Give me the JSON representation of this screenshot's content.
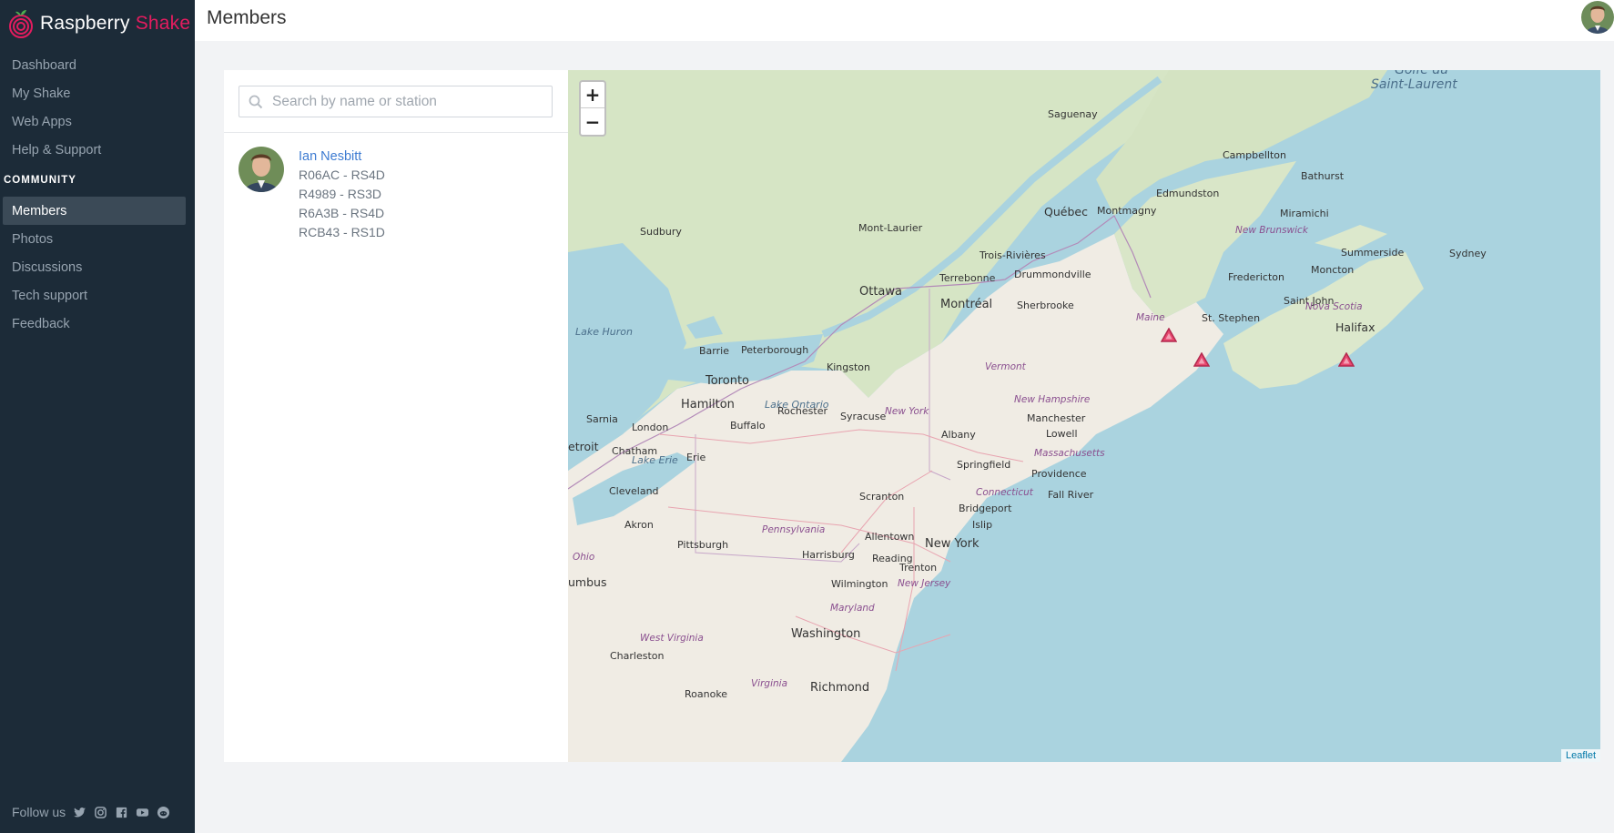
{
  "app": {
    "logo_primary": "Raspberry",
    "logo_accent": "Shake",
    "brand_color": "#e31c5f"
  },
  "sidebar": {
    "items": [
      {
        "label": "Dashboard"
      },
      {
        "label": "My Shake"
      },
      {
        "label": "Web Apps"
      },
      {
        "label": "Help & Support"
      }
    ],
    "section": "COMMUNITY",
    "community_items": [
      {
        "label": "Members",
        "active": true
      },
      {
        "label": "Photos"
      },
      {
        "label": "Discussions"
      },
      {
        "label": "Tech support"
      },
      {
        "label": "Feedback"
      }
    ],
    "follow_label": "Follow us",
    "social_icons": [
      "twitter-icon",
      "instagram-icon",
      "facebook-icon",
      "youtube-icon",
      "reddit-icon"
    ]
  },
  "header": {
    "title": "Members"
  },
  "panel": {
    "search_placeholder": "Search by name or station",
    "members": [
      {
        "name": "Ian Nesbitt",
        "stations": [
          "R06AC - RS4D",
          "R4989 - RS3D",
          "R6A3B - RS4D",
          "RCB43 - RS1D"
        ]
      }
    ]
  },
  "map": {
    "zoom_in": "+",
    "zoom_out": "−",
    "attribution": "Leaflet",
    "labels": {
      "saguenay": "Saguenay",
      "campbellton": "Campbellton",
      "bathurst": "Bathurst",
      "edmundston": "Edmundston",
      "quebec": "Québec",
      "montmagny": "Montmagny",
      "miramichi": "Miramichi",
      "new_brunswick": "New Brunswick",
      "sudbury": "Sudbury",
      "mont_laurier": "Mont-Laurier",
      "summerside": "Summerside",
      "sydney": "Sydney",
      "trois_rivieres": "Trois-Rivières",
      "terrebonne": "Terrebonne",
      "drummondville": "Drummondville",
      "fredericton": "Fredericton",
      "moncton": "Moncton",
      "ottawa": "Ottawa",
      "montreal": "Montréal",
      "sherbrooke": "Sherbrooke",
      "saint_john": "Saint John",
      "nova_scotia": "Nova Scotia",
      "maine": "Maine",
      "st_stephen": "St. Stephen",
      "halifax": "Halifax",
      "lake_huron": "Lake Huron",
      "barrie": "Barrie",
      "peterborough": "Peterborough",
      "vermont": "Vermont",
      "kingston": "Kingston",
      "toronto": "Toronto",
      "lake_ontario": "Lake Ontario",
      "new_hampshire": "New Hampshire",
      "hamilton": "Hamilton",
      "rochester": "Rochester",
      "new_york_state": "New York",
      "syracuse": "Syracuse",
      "manchester": "Manchester",
      "sarnia": "Sarnia",
      "london": "London",
      "buffalo": "Buffalo",
      "albany": "Albany",
      "lowell": "Lowell",
      "detroit": "etroit",
      "chatham": "Chatham",
      "massachusetts": "Massachusetts",
      "lake_erie": "Lake Erie",
      "erie": "Erie",
      "springfield": "Springfield",
      "providence": "Providence",
      "cleveland": "Cleveland",
      "connecticut": "Connecticut",
      "fall_river": "Fall River",
      "scranton": "Scranton",
      "bridgeport": "Bridgeport",
      "akron": "Akron",
      "pennsylvania": "Pennsylvania",
      "islip": "Islip",
      "allentown": "Allentown",
      "pittsburgh": "Pittsburgh",
      "new_york_city": "New York",
      "ohio": "Ohio",
      "harrisburg": "Harrisburg",
      "reading": "Reading",
      "trenton": "Trenton",
      "columbus": "umbus",
      "wilmington": "Wilmington",
      "new_jersey": "New Jersey",
      "maryland": "Maryland",
      "washington": "Washington",
      "west_virginia": "West Virginia",
      "charleston": "Charleston",
      "virginia": "Virginia",
      "roanoke": "Roanoke",
      "richmond": "Richmond",
      "golfe_line1": "Golfe du",
      "golfe_line2": "Saint-Laurent"
    }
  }
}
